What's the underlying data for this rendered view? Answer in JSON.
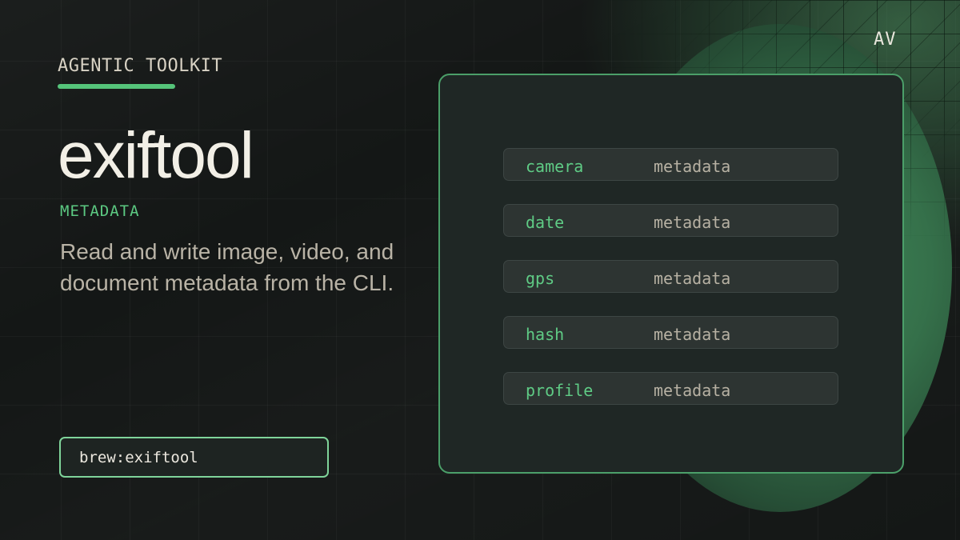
{
  "monogram": "AV",
  "kicker": "AGENTIC TOOLKIT",
  "title": "exiftool",
  "category": "METADATA",
  "description": "Read and write image, video, and document metadata from the CLI.",
  "install_command": "brew:exiftool",
  "fields": [
    {
      "key": "camera",
      "value": "metadata"
    },
    {
      "key": "date",
      "value": "metadata"
    },
    {
      "key": "gps",
      "value": "metadata"
    },
    {
      "key": "hash",
      "value": "metadata"
    },
    {
      "key": "profile",
      "value": "metadata"
    }
  ],
  "colors": {
    "background": "#141716",
    "accent": "#55c47a",
    "panel": "#1f2725",
    "title": "#f2efe6"
  }
}
